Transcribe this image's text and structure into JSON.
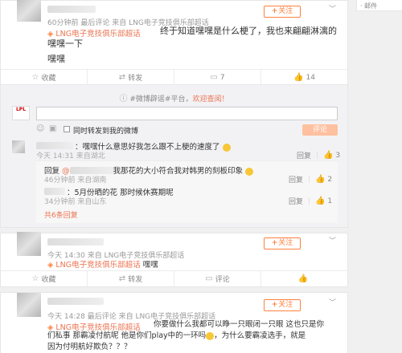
{
  "side_panel": {
    "text": "· 邮件"
  },
  "post1": {
    "time": "60分钟前",
    "last_comment": "最后评论",
    "from": "来自 LNG电子竞技俱乐部超话",
    "follow_label": "关注",
    "source_tag": "LNG电子竞技俱乐部超话",
    "text_line1": "终于知道嘿嘿是什么梗了，我也来翩翩淋漓的嘿嘿一下",
    "text_line2": "嘿嘿",
    "actions": {
      "collect": "收藏",
      "repost": "转发",
      "comment": "7",
      "like": "14"
    }
  },
  "comment_area": {
    "tip": "#微博辟谣#平台，",
    "tip_link": "欢迎查阅！",
    "badge": "LPL",
    "checkbox_label": "同时转发到我的微博",
    "submit_label": "评论",
    "comments": [
      {
        "text": "：嘿嘿什么意思好我怎么跟不上梗的速度了",
        "time": "今天 14:31",
        "from": "来自湖北",
        "reply": "回复",
        "likes": "3"
      }
    ],
    "replies": [
      {
        "prefix": "回复",
        "text": "我那花的大小符合我对韩男的刻板印象",
        "time": "46分钟前",
        "from": "来自湖南",
        "reply": "回复",
        "likes": "2"
      },
      {
        "text": "：5月份晒的花 那时候休赛期呢",
        "time": "34分钟前",
        "from": "来自山东",
        "reply": "回复",
        "likes": "1"
      }
    ],
    "more": "共6条回复"
  },
  "post2": {
    "time": "今天 14:30",
    "from": "来自 LNG电子竞技俱乐部超话",
    "follow_label": "关注",
    "source_tag": "LNG电子竞技俱乐部超话",
    "text": "嘿嘿",
    "actions": {
      "collect": "收藏",
      "repost": "转发",
      "comment": "评论",
      "like": ""
    }
  },
  "post3": {
    "time": "今天 14:28",
    "last_comment": "最后评论",
    "from": "来自 LNG电子竞技俱乐部超话",
    "follow_label": "关注",
    "source_tag": "LNG电子竞技俱乐部超话",
    "text_line1": "你要做什么我都可以睁一只眼闭一只眼 这也只是你",
    "text_line2": "们私事 那霸凌付航呢 他是你们play中的一环吗",
    "text_line2b": "，为什么要霸凌选手，就是",
    "text_line3": "因为付明航好欺负？？？"
  },
  "colors": {
    "accent": "#ff8140",
    "link": "#eb7350"
  }
}
